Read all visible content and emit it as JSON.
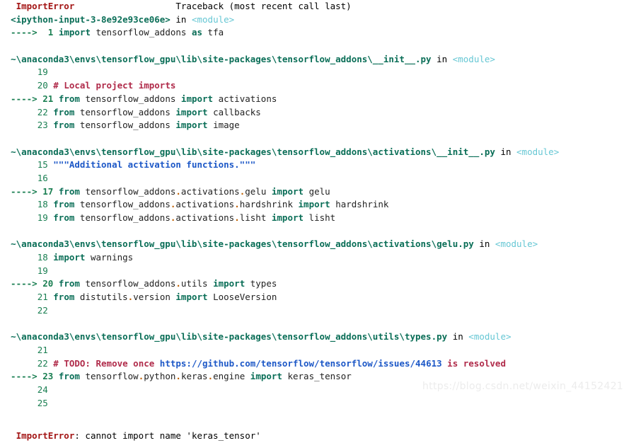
{
  "console": {
    "header": {
      "exception_name": "ImportError",
      "traceback_label": "Traceback (most recent call last)"
    },
    "frames": [
      {
        "location": "<ipython-input-3-8e92e93ce06e>",
        "in_label": "in",
        "scope": "<module>",
        "lines": [
          {
            "marker": "---->",
            "number": "1",
            "segments": [
              {
                "t": "import",
                "c": "kw"
              },
              {
                "t": " tensorflow_addons ",
                "c": "code"
              },
              {
                "t": "as",
                "c": "kw"
              },
              {
                "t": " tfa",
                "c": "code"
              }
            ]
          }
        ]
      },
      {
        "location": "~\\anaconda3\\envs\\tensorflow_gpu\\lib\\site-packages\\tensorflow_addons\\__init__.py",
        "in_label": "in",
        "scope": "<module>",
        "lines": [
          {
            "marker": "",
            "number": "19",
            "segments": []
          },
          {
            "marker": "",
            "number": "20",
            "segments": [
              {
                "t": "# Local project imports",
                "c": "comment"
              }
            ]
          },
          {
            "marker": "---->",
            "number": "21",
            "segments": [
              {
                "t": "from",
                "c": "kw"
              },
              {
                "t": " tensorflow_addons ",
                "c": "code"
              },
              {
                "t": "import",
                "c": "kw"
              },
              {
                "t": " activations",
                "c": "code"
              }
            ]
          },
          {
            "marker": "",
            "number": "22",
            "segments": [
              {
                "t": "from",
                "c": "kw"
              },
              {
                "t": " tensorflow_addons ",
                "c": "code"
              },
              {
                "t": "import",
                "c": "kw"
              },
              {
                "t": " callbacks",
                "c": "code"
              }
            ]
          },
          {
            "marker": "",
            "number": "23",
            "segments": [
              {
                "t": "from",
                "c": "kw"
              },
              {
                "t": " tensorflow_addons ",
                "c": "code"
              },
              {
                "t": "import",
                "c": "kw"
              },
              {
                "t": " image",
                "c": "code"
              }
            ]
          }
        ]
      },
      {
        "location": "~\\anaconda3\\envs\\tensorflow_gpu\\lib\\site-packages\\tensorflow_addons\\activations\\__init__.py",
        "in_label": "in",
        "scope": "<module>",
        "lines": [
          {
            "marker": "",
            "number": "15",
            "segments": [
              {
                "t": "\"\"\"Additional activation functions.\"\"\"",
                "c": "str"
              }
            ]
          },
          {
            "marker": "",
            "number": "16",
            "segments": []
          },
          {
            "marker": "---->",
            "number": "17",
            "segments": [
              {
                "t": "from",
                "c": "kw"
              },
              {
                "t": " tensorflow_addons",
                "c": "code"
              },
              {
                "t": ".",
                "c": "dot"
              },
              {
                "t": "activations",
                "c": "code"
              },
              {
                "t": ".",
                "c": "dot"
              },
              {
                "t": "gelu ",
                "c": "code"
              },
              {
                "t": "import",
                "c": "kw"
              },
              {
                "t": " gelu",
                "c": "code"
              }
            ]
          },
          {
            "marker": "",
            "number": "18",
            "segments": [
              {
                "t": "from",
                "c": "kw"
              },
              {
                "t": " tensorflow_addons",
                "c": "code"
              },
              {
                "t": ".",
                "c": "dot"
              },
              {
                "t": "activations",
                "c": "code"
              },
              {
                "t": ".",
                "c": "dot"
              },
              {
                "t": "hardshrink ",
                "c": "code"
              },
              {
                "t": "import",
                "c": "kw"
              },
              {
                "t": " hardshrink",
                "c": "code"
              }
            ]
          },
          {
            "marker": "",
            "number": "19",
            "segments": [
              {
                "t": "from",
                "c": "kw"
              },
              {
                "t": " tensorflow_addons",
                "c": "code"
              },
              {
                "t": ".",
                "c": "dot"
              },
              {
                "t": "activations",
                "c": "code"
              },
              {
                "t": ".",
                "c": "dot"
              },
              {
                "t": "lisht ",
                "c": "code"
              },
              {
                "t": "import",
                "c": "kw"
              },
              {
                "t": " lisht",
                "c": "code"
              }
            ]
          }
        ]
      },
      {
        "location": "~\\anaconda3\\envs\\tensorflow_gpu\\lib\\site-packages\\tensorflow_addons\\activations\\gelu.py",
        "in_label": "in",
        "scope": "<module>",
        "lines": [
          {
            "marker": "",
            "number": "18",
            "segments": [
              {
                "t": "import",
                "c": "kw"
              },
              {
                "t": " warnings",
                "c": "code"
              }
            ]
          },
          {
            "marker": "",
            "number": "19",
            "segments": []
          },
          {
            "marker": "---->",
            "number": "20",
            "segments": [
              {
                "t": "from",
                "c": "kw"
              },
              {
                "t": " tensorflow_addons",
                "c": "code"
              },
              {
                "t": ".",
                "c": "dot"
              },
              {
                "t": "utils ",
                "c": "code"
              },
              {
                "t": "import",
                "c": "kw"
              },
              {
                "t": " types",
                "c": "code"
              }
            ]
          },
          {
            "marker": "",
            "number": "21",
            "segments": [
              {
                "t": "from",
                "c": "kw"
              },
              {
                "t": " distutils",
                "c": "code"
              },
              {
                "t": ".",
                "c": "dot"
              },
              {
                "t": "version ",
                "c": "code"
              },
              {
                "t": "import",
                "c": "kw"
              },
              {
                "t": " LooseVersion",
                "c": "code"
              }
            ]
          },
          {
            "marker": "",
            "number": "22",
            "segments": []
          }
        ]
      },
      {
        "location": "~\\anaconda3\\envs\\tensorflow_gpu\\lib\\site-packages\\tensorflow_addons\\utils\\types.py",
        "in_label": "in",
        "scope": "<module>",
        "lines": [
          {
            "marker": "",
            "number": "21",
            "segments": []
          },
          {
            "marker": "",
            "number": "22",
            "segments": [
              {
                "t": "# TODO: Remove once ",
                "c": "comment"
              },
              {
                "t": "https://github.com/tensorflow/tensorflow/issues/44613",
                "c": "str"
              },
              {
                "t": " is resolved",
                "c": "comment"
              }
            ]
          },
          {
            "marker": "---->",
            "number": "23",
            "segments": [
              {
                "t": "from",
                "c": "kw"
              },
              {
                "t": " tensorflow",
                "c": "code"
              },
              {
                "t": ".",
                "c": "dot"
              },
              {
                "t": "python",
                "c": "code"
              },
              {
                "t": ".",
                "c": "dot"
              },
              {
                "t": "keras",
                "c": "code"
              },
              {
                "t": ".",
                "c": "dot"
              },
              {
                "t": "engine ",
                "c": "code"
              },
              {
                "t": "import",
                "c": "kw"
              },
              {
                "t": " keras_tensor",
                "c": "code"
              }
            ]
          },
          {
            "marker": "",
            "number": "24",
            "segments": []
          },
          {
            "marker": "",
            "number": "25",
            "segments": []
          }
        ]
      }
    ],
    "final_error": {
      "name": "ImportError",
      "message": ": cannot import name 'keras_tensor'"
    }
  },
  "watermark": {
    "text": "https://blog.csdn.net/weixin_44152421"
  }
}
